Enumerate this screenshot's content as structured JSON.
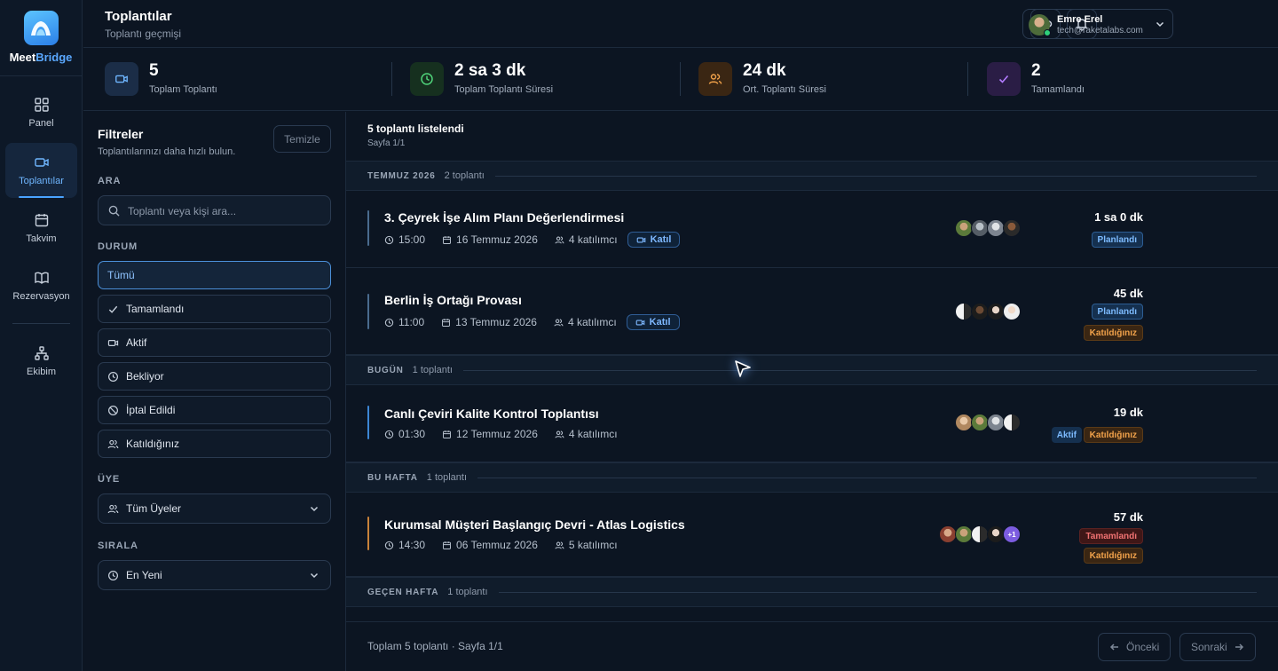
{
  "brand": {
    "name_a": "Meet",
    "name_b": "Bridge"
  },
  "nav": [
    {
      "label": "Panel",
      "icon": "grid-icon"
    },
    {
      "label": "Toplantılar",
      "icon": "video-icon",
      "active": true
    },
    {
      "label": "Takvim",
      "icon": "calendar-icon"
    },
    {
      "label": "Rezervasyon",
      "icon": "book-icon"
    },
    {
      "label": "Ekibim",
      "icon": "team-icon"
    }
  ],
  "header": {
    "title": "Toplantılar",
    "subtitle": "Toplantı geçmişi"
  },
  "user": {
    "name": "Emre Erel",
    "email": "tech@raketalabs.com"
  },
  "stats": [
    {
      "value": "5",
      "label": "Toplam Toplantı",
      "icon": "video-icon",
      "color": "#6fb6ff"
    },
    {
      "value": "2 sa 3 dk",
      "label": "Toplam Toplantı Süresi",
      "icon": "clock-icon",
      "color": "#4fd37a"
    },
    {
      "value": "24 dk",
      "label": "Ort. Toplantı Süresi",
      "icon": "users-icon",
      "color": "#f0a14a"
    },
    {
      "value": "2",
      "label": "Tamamlandı",
      "icon": "check-icon",
      "color": "#b27cff"
    }
  ],
  "filters": {
    "title": "Filtreler",
    "subtitle": "Toplantılarınızı daha hızlı bulun.",
    "clear": "Temizle",
    "search_section": "ARA",
    "search_placeholder": "Toplantı veya kişi ara...",
    "status_section": "DURUM",
    "statuses": [
      "Tümü",
      "Tamamlandı",
      "Aktif",
      "Bekliyor",
      "İptal Edildi",
      "Katıldığınız"
    ],
    "member_section": "ÜYE",
    "member_value": "Tüm Üyeler",
    "sort_section": "SIRALA",
    "sort_value": "En Yeni"
  },
  "list": {
    "count_title": "5 toplantı listelendi",
    "page": "Sayfa 1/1",
    "groups": [
      {
        "name": "TEMMUZ 2026",
        "count": "2 toplantı"
      },
      {
        "name": "BUGÜN",
        "count": "1 toplantı"
      },
      {
        "name": "BU HAFTA",
        "count": "1 toplantı"
      },
      {
        "name": "GEÇEN HAFTA",
        "count": "1 toplantı"
      }
    ],
    "meetings": [
      {
        "title": "3. Çeyrek İşe Alım Planı Değerlendirmesi",
        "time": "15:00",
        "date": "16 Temmuz 2026",
        "participants": "4 katılımcı",
        "join": "Katıl",
        "duration": "1 sa 0 dk",
        "badges": [
          "Planlandı"
        ]
      },
      {
        "title": "Berlin İş Ortağı Provası",
        "time": "11:00",
        "date": "13 Temmuz 2026",
        "participants": "4 katılımcı",
        "join": "Katıl",
        "duration": "45 dk",
        "badges": [
          "Planlandı",
          "Katıldığınız"
        ]
      },
      {
        "title": "Canlı Çeviri Kalite Kontrol Toplantısı",
        "time": "01:30",
        "date": "12 Temmuz 2026",
        "participants": "4 katılımcı",
        "join": "",
        "duration": "19 dk",
        "badges": [
          "Aktif",
          "Katıldığınız"
        ]
      },
      {
        "title": "Kurumsal Müşteri Başlangıç Devri - Atlas Logistics",
        "time": "14:30",
        "date": "06 Temmuz 2026",
        "participants": "5 katılımcı",
        "join": "",
        "duration": "57 dk",
        "badges": [
          "Tamamlandı",
          "Katıldığınız"
        ],
        "extra": "+1"
      }
    ]
  },
  "footer": {
    "summary": "Toplam 5 toplantı · Sayfa 1/1",
    "prev": "Önceki",
    "next": "Sonraki"
  }
}
